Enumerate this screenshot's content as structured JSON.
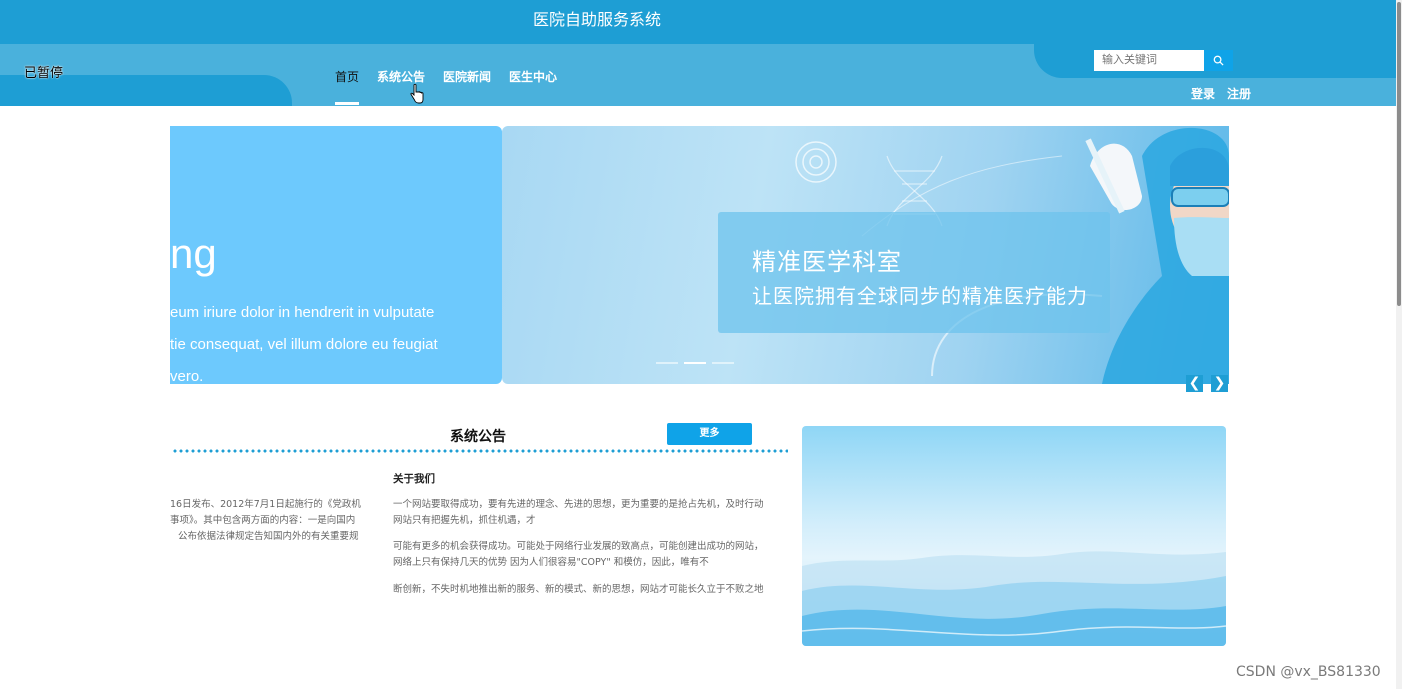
{
  "header": {
    "site_title": "医院自助服务系统",
    "status_label": "已暂停"
  },
  "nav": {
    "items": [
      {
        "label": "首页"
      },
      {
        "label": "系统公告"
      },
      {
        "label": "医院新闻"
      },
      {
        "label": "医生中心"
      }
    ]
  },
  "search": {
    "placeholder": "输入关键词"
  },
  "auth": {
    "login": "登录",
    "register": "注册"
  },
  "carousel": {
    "left_big": "ng",
    "left_lines": [
      "eum iriure dolor in hendrerit in vulputate",
      "tie consequat, vel illum dolore eu feugiat",
      "vero."
    ],
    "main_title": "精准医学科室",
    "main_subtitle": "让医院拥有全球同步的精准医疗能力",
    "prev_symbol": "❮",
    "next_symbol": "❯"
  },
  "notice": {
    "title": "系统公告",
    "more_label": "更多",
    "left_lines": [
      "16日发布、2012年7月1日起施行的《党政机",
      "事项》。其中包含两方面的内容：一是向国内",
      "公布依据法律规定告知国内外的有关重要规"
    ],
    "about_title": "关于我们",
    "about_paragraphs": [
      [
        "一个网站要取得成功，要有先进的理念、先进的思想，更为重要的是抢占先机，及时行动",
        "网站只有把握先机，抓住机遇，才"
      ],
      [
        "可能有更多的机会获得成功。可能处于网络行业发展的致高点，可能创建出成功的网站，",
        "网络上只有保持几天的优势 因为人们很容易\"COPY\" 和模仿，因此，唯有不"
      ],
      [
        "断创新，不失时机地推出新的服务、新的模式、新的思想，网站才可能长久立于不败之地"
      ]
    ]
  },
  "watermark": "CSDN @vx_BS81330"
}
